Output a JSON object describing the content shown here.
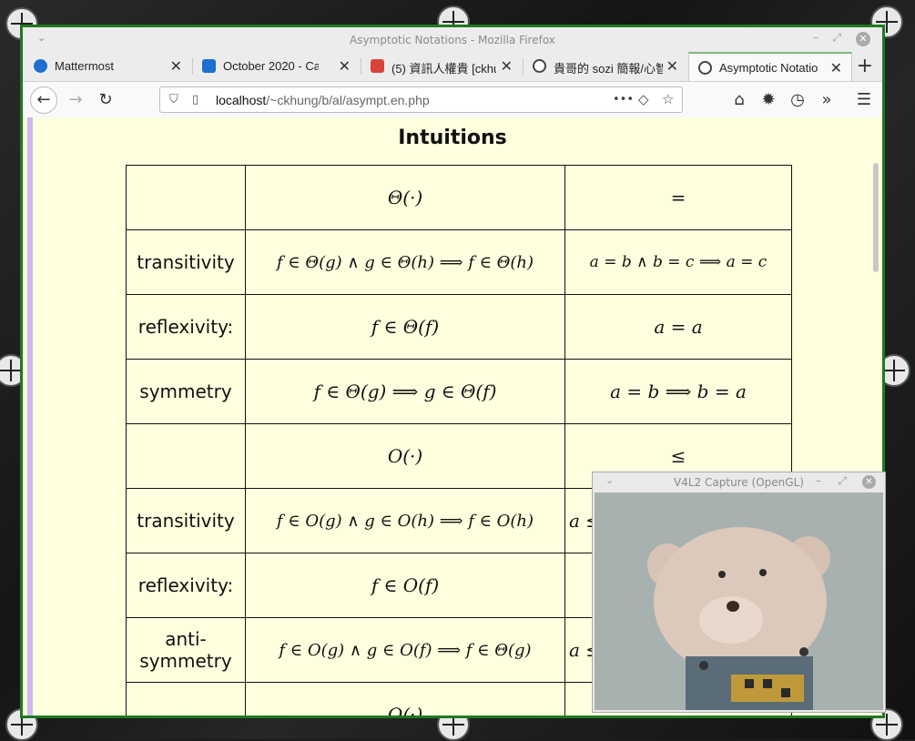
{
  "window": {
    "title": "Asymptotic Notations - Mozilla Firefox",
    "menu_glyph": "⌄",
    "minimize": "–",
    "maximize": "⤢",
    "close": "✕"
  },
  "tabs": [
    {
      "label": "Mattermost",
      "icon": "mattermost-icon",
      "color": "#1e6fcf"
    },
    {
      "label": "October 2020 - Cale",
      "icon": "calendar-icon",
      "color": "#1e6fcf"
    },
    {
      "label": "(5) 資訊人權貴 [ckhu",
      "icon": "notification-icon",
      "color": "#d9443a"
    },
    {
      "label": "貴哥的 sozi 簡報/心智",
      "icon": "site-icon",
      "color": "#444444"
    },
    {
      "label": "Asymptotic Notatio",
      "icon": "site-icon",
      "color": "#444444",
      "active": true
    }
  ],
  "tab_close": "✕",
  "new_tab": "+",
  "navbar": {
    "back": "←",
    "forward": "→",
    "reload": "↻",
    "url_host": "localhost",
    "url_path": "/~ckhung/b/al/asympt.en.php",
    "page_actions": "•••",
    "pocket": "◇",
    "star": "☆",
    "home": "⌂",
    "settings": "✹",
    "history": "◷",
    "overflow": "»",
    "menu": "☰"
  },
  "page": {
    "heading": "Intuitions",
    "rows": [
      {
        "label": "",
        "notation": "Θ(·)",
        "analogy": "="
      },
      {
        "label": "transitivity",
        "notation": "f ∈ Θ(g)  ∧  g ∈ Θ(h) ⟹ f ∈ Θ(h)",
        "analogy": "a = b  ∧  b = c ⟹ a = c"
      },
      {
        "label": "reflexivity:",
        "notation": "f ∈ Θ(f)",
        "analogy": "a = a"
      },
      {
        "label": "symmetry",
        "notation": "f ∈ Θ(g) ⟹ g ∈ Θ(f)",
        "analogy": "a = b ⟹ b = a"
      },
      {
        "label": "",
        "notation": "O(·)",
        "analogy": "≤"
      },
      {
        "label": "transitivity",
        "notation": "f ∈ O(g)  ∧  g ∈ O(h) ⟹ f ∈ O(h)",
        "analogy": "a ≤"
      },
      {
        "label": "reflexivity:",
        "notation": "f ∈ O(f)",
        "analogy": ""
      },
      {
        "label": "anti-symmetry",
        "notation": "f ∈ O(g)  ∧  g ∈ O(f) ⟹ f ∈ Θ(g)",
        "analogy": "a ≤"
      },
      {
        "label": "",
        "notation": "Ω(·)",
        "analogy": ""
      }
    ]
  },
  "v4l2": {
    "title": "V4L2 Capture (OpenGL)",
    "menu_glyph": "⌄",
    "minimize": "–",
    "maximize": "⤢",
    "close": "✕"
  }
}
